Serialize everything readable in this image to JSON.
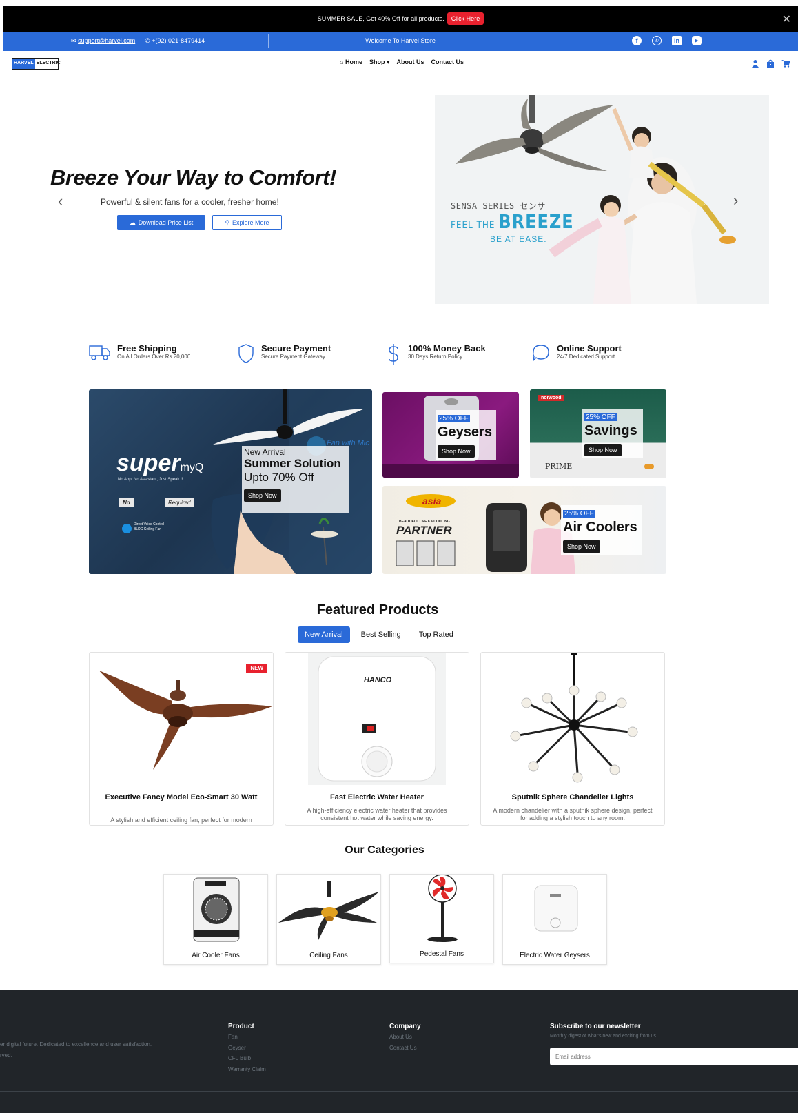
{
  "topbar": {
    "text": "SUMMER SALE, Get 40% Off for all products.",
    "cta": "Click Here",
    "close": "✕"
  },
  "contactbar": {
    "email": "support@harvel.com",
    "phone": "+(92) 021-8479414",
    "welcome": "Welcome To Harvel Store"
  },
  "logo": {
    "part1": "HARVEL",
    "part2": "ELECTRIC"
  },
  "nav": {
    "home": "Home",
    "shop": "Shop ▾",
    "about": "About Us",
    "contact": "Contact Us"
  },
  "hero": {
    "title": "Breeze Your Way to Comfort!",
    "subtitle": "Powerful & silent fans for a cooler, fresher home!",
    "download_btn": "Download Price List",
    "explore_btn": "Explore More",
    "image_line1": "SENSA SERIES センサ",
    "image_line2a": "FEEL THE ",
    "image_line2b": "BREEZE",
    "image_line3": "BE AT EASE."
  },
  "features": [
    {
      "title": "Free Shipping",
      "sub": "On All Orders Over Rs.20,000"
    },
    {
      "title": "Secure Payment",
      "sub": "Secure Payment Gateway."
    },
    {
      "title": "100% Money Back",
      "sub": "30 Days Return Policy."
    },
    {
      "title": "Online Support",
      "sub": "24/7 Dedicated Support."
    }
  ],
  "banners": {
    "main": {
      "tag": "New Arrival",
      "title": "Summer Solution",
      "offer": "Upto 70% Off",
      "btn": "Shop Now",
      "brand": "super",
      "brand_small": "myQ",
      "tagline": "No App, No Assistant, Just Speak !!",
      "no": "No",
      "required": "Required",
      "fan_with_mic": "Fan with Mic",
      "voice": "Direct Voice Control",
      "voice2": "BLDC Ceiling Fan"
    },
    "geysers": {
      "tag": "25% OFF",
      "title": "Geysers",
      "btn": "Shop Now"
    },
    "savings": {
      "tag": "25% OFF",
      "title": "Savings",
      "btn": "Shop Now",
      "brand": "norwood",
      "prime": "PRIME"
    },
    "coolers": {
      "tag": "25% OFF",
      "title": "Air Coolers",
      "btn": "Shop Now",
      "brand": "asia",
      "partner": "PARTNER",
      "partner_pre": "BEAUTIFUL LIFE KA COOLING"
    }
  },
  "featured": {
    "title": "Featured Products",
    "tabs": [
      "New Arrival",
      "Best Selling",
      "Top Rated"
    ],
    "products": [
      {
        "name": "Executive Fancy Model Eco-Smart 30 Watt",
        "desc": "A stylish and efficient ceiling fan, perfect for modern",
        "badge": "NEW"
      },
      {
        "name": "Fast Electric Water Heater",
        "desc": "A high-efficiency electric water heater that provides consistent hot water while saving energy.",
        "brand": "HANCO"
      },
      {
        "name": "Sputnik Sphere Chandelier Lights",
        "desc": "A modern chandelier with a sputnik sphere design, perfect for adding a stylish touch to any room."
      }
    ]
  },
  "categories": {
    "title": "Our Categories",
    "items": [
      "Air Cooler Fans",
      "Ceiling Fans",
      "Pedestal Fans",
      "Electric Water Geysers"
    ]
  },
  "footer": {
    "about_line1": "er digital future. Dedicated to excellence and user satisfaction.",
    "about_line2": "rved.",
    "product_title": "Product",
    "product_links": [
      "Fan",
      "Geyser",
      "CFL Bulb",
      "Warranty Claim"
    ],
    "company_title": "Company",
    "company_links": [
      "About Us",
      "Contact Us"
    ],
    "newsletter_title": "Subscribe to our newsletter",
    "newsletter_sub": "Monthly digest of what's new and exciting from us.",
    "email_placeholder": "Email address"
  },
  "colors": {
    "brand_blue": "#2a6ad8",
    "sale_red": "#e8212e",
    "footer_bg": "#212529"
  }
}
